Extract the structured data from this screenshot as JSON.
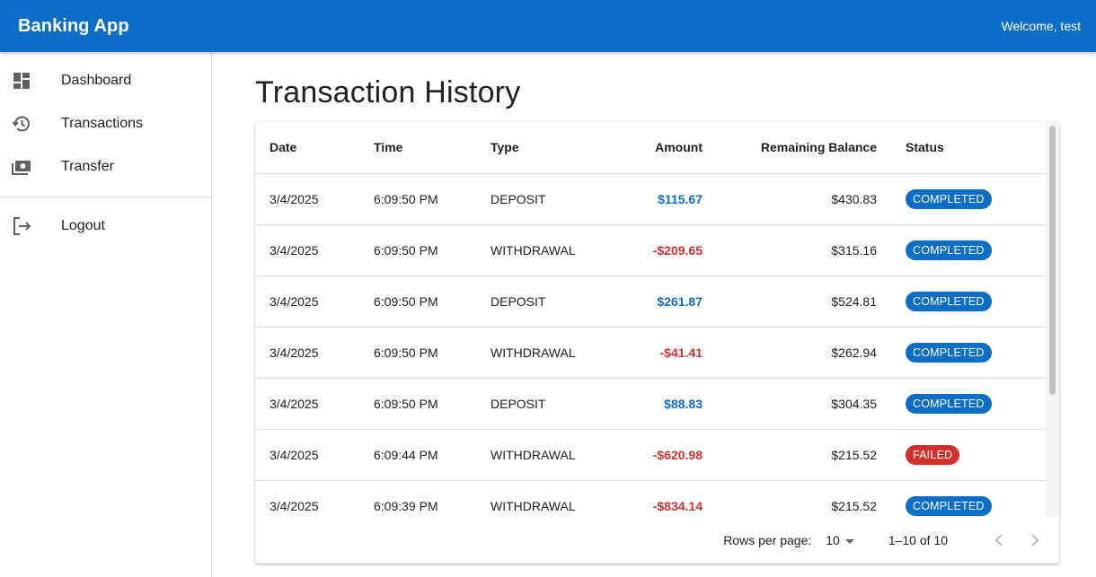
{
  "app": {
    "title": "Banking App",
    "welcome": "Welcome, test"
  },
  "sidebar": {
    "items": [
      {
        "label": "Dashboard",
        "icon": "dashboard-icon"
      },
      {
        "label": "Transactions",
        "icon": "history-icon"
      },
      {
        "label": "Transfer",
        "icon": "money-icon"
      }
    ],
    "logout": {
      "label": "Logout",
      "icon": "logout-icon"
    }
  },
  "main": {
    "title": "Transaction History"
  },
  "table": {
    "headers": [
      "Date",
      "Time",
      "Type",
      "Amount",
      "Remaining Balance",
      "Status"
    ],
    "rows": [
      {
        "date": "3/4/2025",
        "time": "6:09:50 PM",
        "type": "DEPOSIT",
        "amount": "$115.67",
        "balance": "$430.83",
        "status": "COMPLETED"
      },
      {
        "date": "3/4/2025",
        "time": "6:09:50 PM",
        "type": "WITHDRAWAL",
        "amount": "-$209.65",
        "balance": "$315.16",
        "status": "COMPLETED"
      },
      {
        "date": "3/4/2025",
        "time": "6:09:50 PM",
        "type": "DEPOSIT",
        "amount": "$261.87",
        "balance": "$524.81",
        "status": "COMPLETED"
      },
      {
        "date": "3/4/2025",
        "time": "6:09:50 PM",
        "type": "WITHDRAWAL",
        "amount": "-$41.41",
        "balance": "$262.94",
        "status": "COMPLETED"
      },
      {
        "date": "3/4/2025",
        "time": "6:09:50 PM",
        "type": "DEPOSIT",
        "amount": "$88.83",
        "balance": "$304.35",
        "status": "COMPLETED"
      },
      {
        "date": "3/4/2025",
        "time": "6:09:44 PM",
        "type": "WITHDRAWAL",
        "amount": "-$620.98",
        "balance": "$215.52",
        "status": "FAILED"
      },
      {
        "date": "3/4/2025",
        "time": "6:09:39 PM",
        "type": "WITHDRAWAL",
        "amount": "-$834.14",
        "balance": "$215.52",
        "status": "COMPLETED"
      }
    ]
  },
  "pagination": {
    "rows_label": "Rows per page:",
    "rows_value": "10",
    "range": "1–10 of 10"
  },
  "colors": {
    "primary": "#0d6ec8",
    "negative": "#d32f2f",
    "failed": "#d32f2f",
    "completed": "#0d6ec8"
  }
}
